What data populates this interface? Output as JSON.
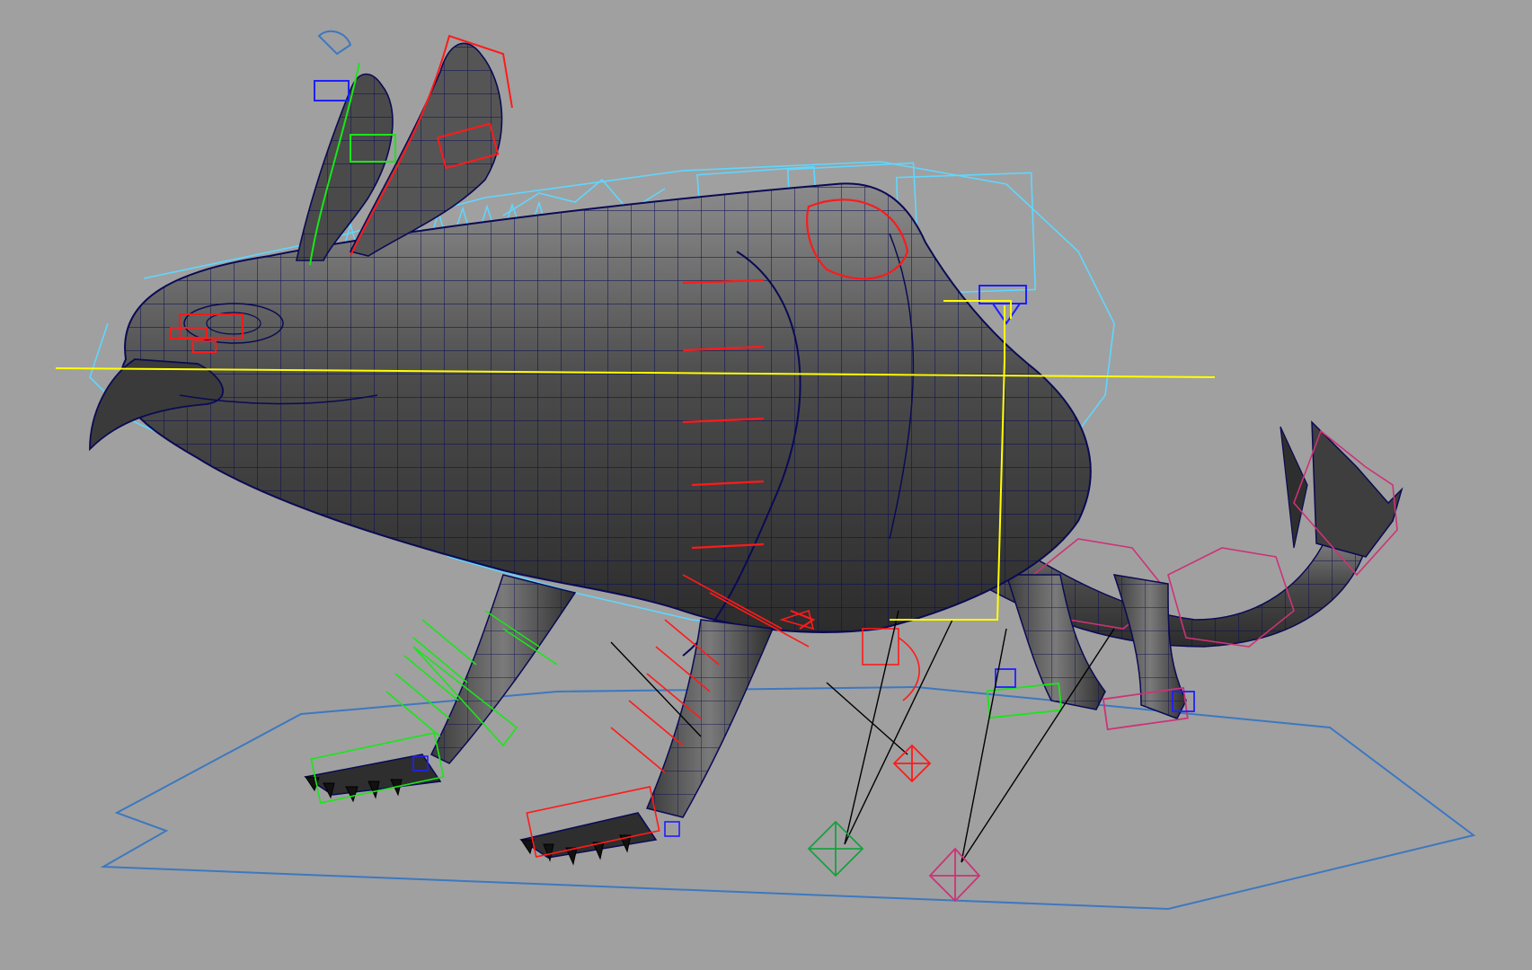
{
  "viewport": {
    "background_color": "#a0a0a0",
    "subject": "rigged-creature-model",
    "wire_color": "#0a0a55",
    "mesh_shade_light": "#8a8a8a",
    "mesh_shade_dark": "#3a3a3a",
    "control_colors": {
      "center": "#ffff00",
      "left": "#ff1a1a",
      "right": "#19e619",
      "ik": "#1f1fff",
      "spine": "#5fd7ff",
      "tail": "#cc3377",
      "ground": "#3d78c0",
      "pole_line": "#000000"
    }
  }
}
